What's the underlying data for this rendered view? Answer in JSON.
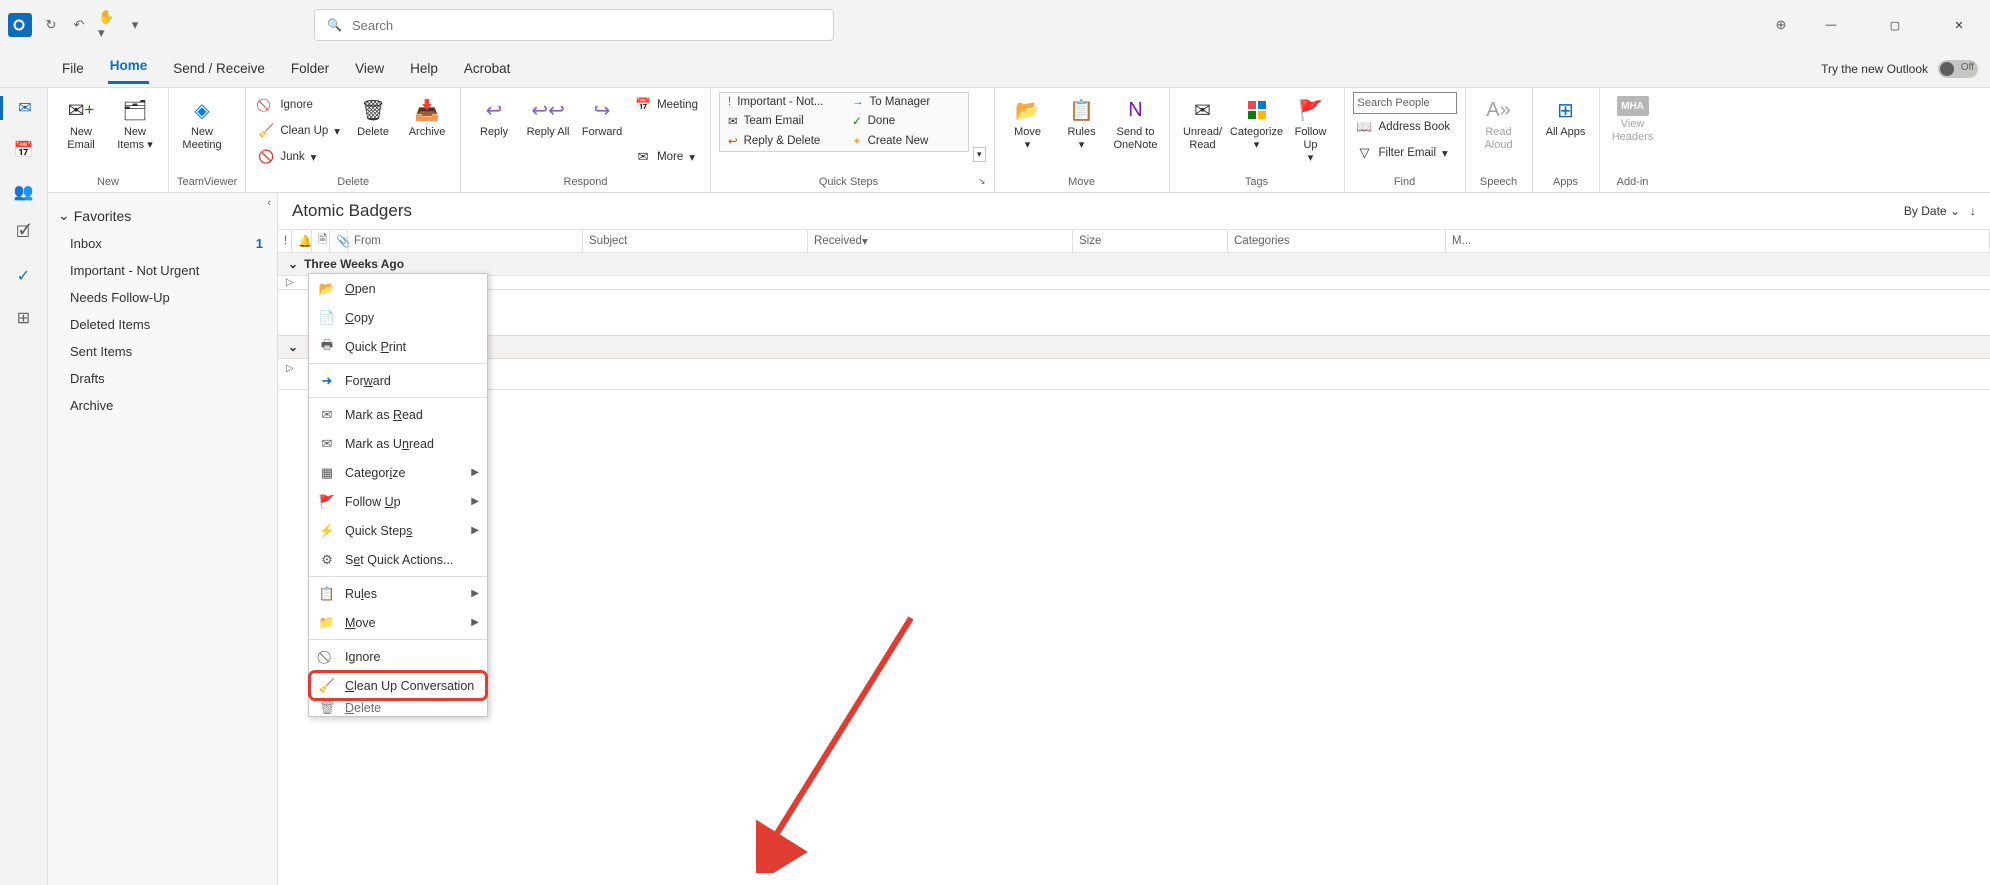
{
  "titlebar": {
    "search_placeholder": "Search",
    "try_label": "Try the new Outlook",
    "toggle_state": "Off"
  },
  "menubar": [
    "File",
    "Home",
    "Send / Receive",
    "Folder",
    "View",
    "Help",
    "Acrobat"
  ],
  "ribbon": {
    "new": {
      "label": "New",
      "email": "New Email",
      "items": "New Items"
    },
    "teamviewer": {
      "label": "TeamViewer",
      "meeting": "New Meeting"
    },
    "delete": {
      "label": "Delete",
      "ignore": "Ignore",
      "cleanup": "Clean Up",
      "junk": "Junk",
      "delete": "Delete",
      "archive": "Archive"
    },
    "respond": {
      "label": "Respond",
      "reply": "Reply",
      "replyall": "Reply All",
      "forward": "Forward",
      "meeting": "Meeting",
      "more": "More"
    },
    "quicksteps": {
      "label": "Quick Steps",
      "items": [
        "Important - Not...",
        "To Manager",
        "Team Email",
        "Done",
        "Reply & Delete",
        "Create New"
      ]
    },
    "move": {
      "label": "Move",
      "move": "Move",
      "rules": "Rules",
      "onenote": "Send to OneNote"
    },
    "tags": {
      "label": "Tags",
      "unread": "Unread/ Read",
      "categorize": "Categorize",
      "followup": "Follow Up"
    },
    "find": {
      "label": "Find",
      "search_people": "Search People",
      "address": "Address Book",
      "filter": "Filter Email"
    },
    "speech": {
      "label": "Speech",
      "read": "Read Aloud"
    },
    "apps": {
      "label": "Apps",
      "all": "All Apps"
    },
    "addin": {
      "label": "Add-in",
      "view": "View Headers",
      "badge": "MHA"
    }
  },
  "folders": {
    "favorites_label": "Favorites",
    "items": [
      {
        "name": "Inbox",
        "count": "1"
      },
      {
        "name": "Important - Not Urgent"
      },
      {
        "name": "Needs Follow-Up"
      },
      {
        "name": "Deleted Items"
      },
      {
        "name": "Sent Items"
      },
      {
        "name": "Drafts"
      },
      {
        "name": "Archive"
      }
    ]
  },
  "mail": {
    "folder_title": "Atomic Badgers",
    "sort_label": "By Date",
    "columns": {
      "from": "From",
      "subject": "Subject",
      "received": "Received",
      "size": "Size",
      "categories": "Categories",
      "m": "M..."
    },
    "group1": "Three Weeks Ago"
  },
  "context_menu": [
    {
      "icon": "open",
      "label_pre": "",
      "accel": "O",
      "label_post": "pen"
    },
    {
      "icon": "copy",
      "label_pre": "",
      "accel": "C",
      "label_post": "opy"
    },
    {
      "icon": "print",
      "label_pre": "Quick ",
      "accel": "P",
      "label_post": "rint"
    },
    {
      "sep": true
    },
    {
      "icon": "forward",
      "label_pre": "For",
      "accel": "w",
      "label_post": "ard"
    },
    {
      "sep": true
    },
    {
      "icon": "read",
      "label_pre": "Mark as ",
      "accel": "R",
      "label_post": "ead"
    },
    {
      "icon": "unread",
      "label_pre": "Mark as U",
      "accel": "n",
      "label_post": "read"
    },
    {
      "icon": "categorize",
      "label_pre": "Categor",
      "accel": "i",
      "label_post": "ze",
      "sub": true
    },
    {
      "icon": "flag",
      "label_pre": "Follow ",
      "accel": "U",
      "label_post": "p",
      "sub": true
    },
    {
      "icon": "bolt",
      "label_pre": "Quick Step",
      "accel": "s",
      "label_post": "",
      "sub": true
    },
    {
      "icon": "gear",
      "label_pre": "S",
      "accel": "e",
      "label_post": "t Quick Actions..."
    },
    {
      "sep": true
    },
    {
      "icon": "rules",
      "label_pre": "Ru",
      "accel": "l",
      "label_post": "es",
      "sub": true
    },
    {
      "icon": "move",
      "label_pre": "",
      "accel": "M",
      "label_post": "ove",
      "sub": true
    },
    {
      "sep": true
    },
    {
      "icon": "ignore",
      "label_pre": "I",
      "accel": "g",
      "label_post": "nore"
    },
    {
      "icon": "clean",
      "label_pre": "",
      "accel": "C",
      "label_post": "lean Up Conversation",
      "highlight": true
    },
    {
      "icon": "delete",
      "label_pre": "",
      "accel": "D",
      "label_post": "elete",
      "cut": true
    }
  ]
}
